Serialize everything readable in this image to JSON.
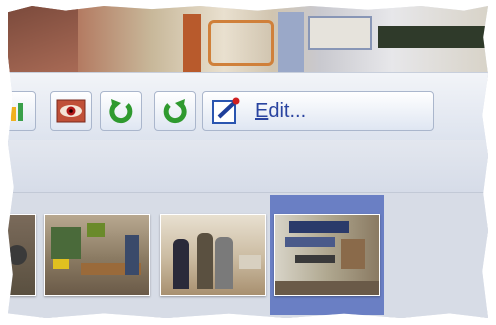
{
  "toolbar": {
    "edit_label": "Edit...",
    "edit_mnemonic": "E",
    "edit_rest": "dit..."
  },
  "filmstrip": {
    "thumbnails": [
      "workshop-partial",
      "workshop-machines",
      "group-of-people",
      "rotated-photo"
    ],
    "selected_index": 3
  },
  "colors": {
    "selection": "#6a7fc4",
    "toolbar_bg": "#e6eaf2",
    "edit_text": "#2a44a0"
  }
}
